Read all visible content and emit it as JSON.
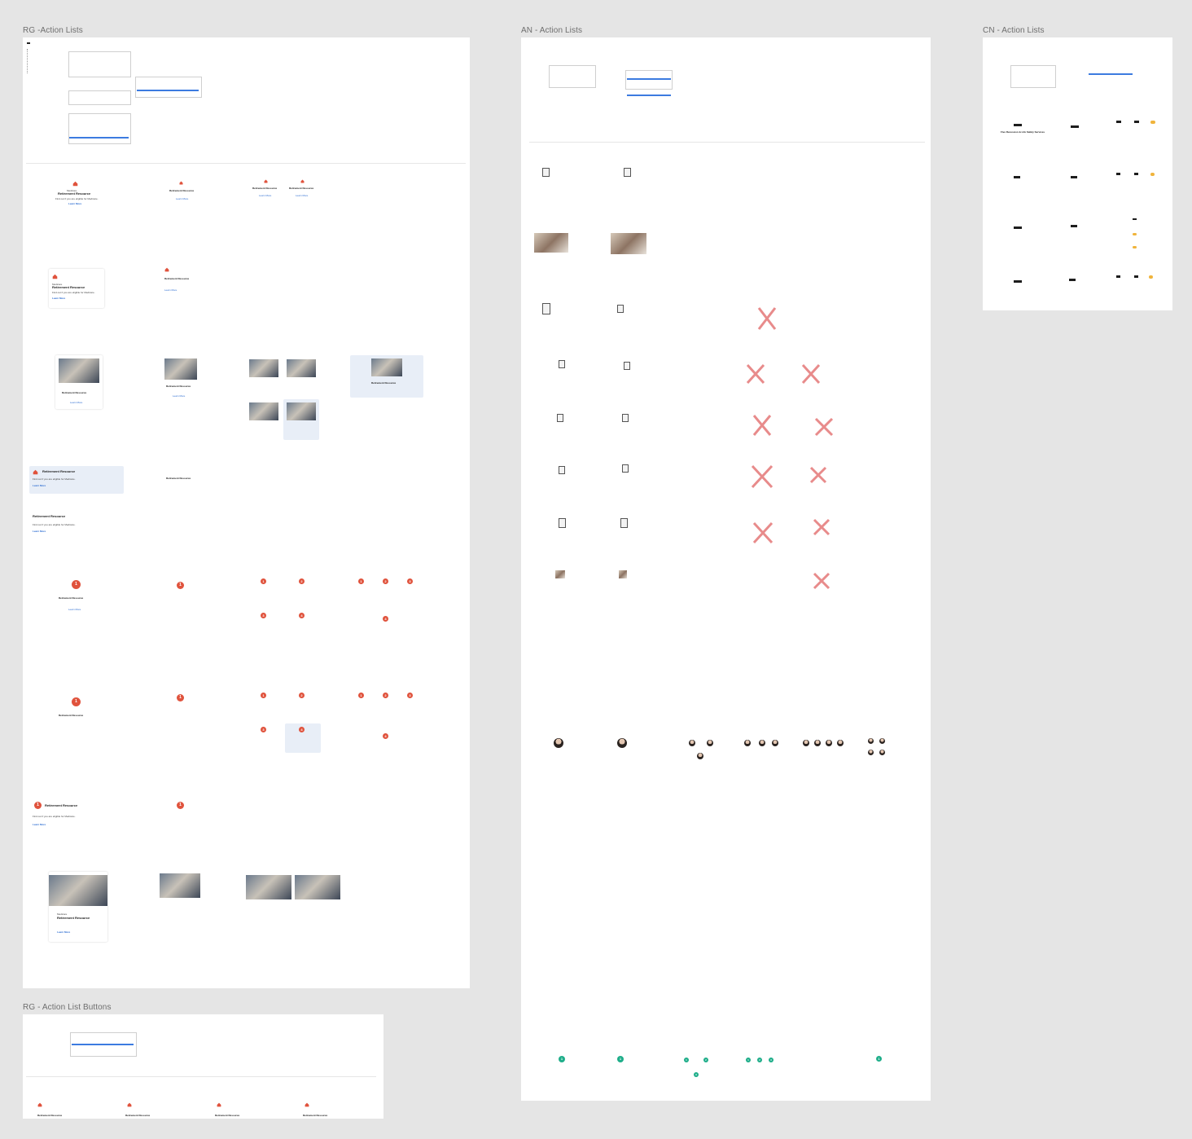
{
  "frames": {
    "rg_action_lists": {
      "title": "RG -Action Lists"
    },
    "an_action_lists": {
      "title": "AN - Action Lists"
    },
    "cn_action_lists": {
      "title": "CN - Action Lists"
    },
    "rg_action_list_buttons": {
      "title": "RG - Action List Buttons"
    }
  },
  "card": {
    "eyebrow": "Medicare",
    "title": "Retirement Resource",
    "body": "Find out if you are eligible for Medicare.",
    "link": "Learn More"
  },
  "badges": [
    "1",
    "2",
    "3",
    "4"
  ],
  "cn_card_title": "Five Recession & Life Safety Services",
  "colors": {
    "canvas": "#e5e5e5",
    "frame": "#ffffff",
    "accent_red": "#e0533d",
    "link_blue": "#2a6bd1",
    "accent_green": "#1fae8a",
    "selection_blue": "#3c7be0"
  }
}
